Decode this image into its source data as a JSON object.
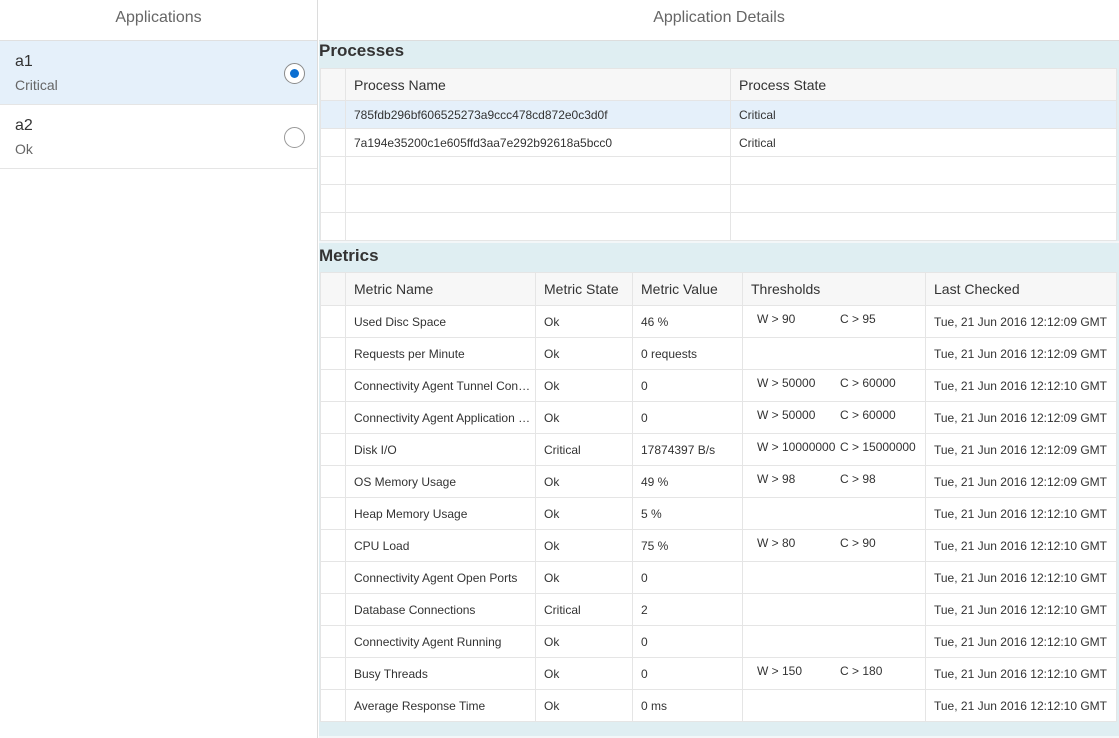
{
  "master": {
    "title": "Applications",
    "items": [
      {
        "name": "a1",
        "status": "Critical",
        "selected": true
      },
      {
        "name": "a2",
        "status": "Ok",
        "selected": false
      }
    ]
  },
  "detail": {
    "title": "Application Details",
    "processes": {
      "title": "Processes",
      "columns": [
        "Process Name",
        "Process State"
      ],
      "rows": [
        {
          "name": "785fdb296bf606525273a9ccc478cd872e0c3d0f",
          "state": "Critical"
        },
        {
          "name": "7a194e35200c1e605ffd3aa7e292b92618a5bcc0",
          "state": "Critical"
        }
      ]
    },
    "metrics": {
      "title": "Metrics",
      "columns": [
        "Metric Name",
        "Metric State",
        "Metric Value",
        "Thresholds",
        "Last Checked"
      ],
      "rows": [
        {
          "name": "Used Disc Space",
          "state": "Ok",
          "value": "46 %",
          "warn": "W > 90",
          "crit": "C > 95",
          "checked": "Tue, 21 Jun 2016 12:12:09 GMT"
        },
        {
          "name": "Requests per Minute",
          "state": "Ok",
          "value": "0 requests",
          "warn": "",
          "crit": "",
          "checked": "Tue, 21 Jun 2016 12:12:09 GMT"
        },
        {
          "name": "Connectivity Agent Tunnel Connections",
          "state": "Ok",
          "value": "0",
          "warn": "W > 50000",
          "crit": "C > 60000",
          "checked": "Tue, 21 Jun 2016 12:12:10 GMT"
        },
        {
          "name": "Connectivity Agent Application Connections",
          "state": "Ok",
          "value": "0",
          "warn": "W > 50000",
          "crit": "C > 60000",
          "checked": "Tue, 21 Jun 2016 12:12:09 GMT"
        },
        {
          "name": "Disk I/O",
          "state": "Critical",
          "value": "17874397 B/s",
          "warn": "W > 10000000",
          "crit": "C > 15000000",
          "checked": "Tue, 21 Jun 2016 12:12:09 GMT"
        },
        {
          "name": "OS Memory Usage",
          "state": "Ok",
          "value": "49 %",
          "warn": "W > 98",
          "crit": "C > 98",
          "checked": "Tue, 21 Jun 2016 12:12:09 GMT"
        },
        {
          "name": "Heap Memory Usage",
          "state": "Ok",
          "value": "5 %",
          "warn": "",
          "crit": "",
          "checked": "Tue, 21 Jun 2016 12:12:10 GMT"
        },
        {
          "name": "CPU Load",
          "state": "Ok",
          "value": "75 %",
          "warn": "W > 80",
          "crit": "C > 90",
          "checked": "Tue, 21 Jun 2016 12:12:10 GMT"
        },
        {
          "name": "Connectivity Agent Open Ports",
          "state": "Ok",
          "value": "0",
          "warn": "",
          "crit": "",
          "checked": "Tue, 21 Jun 2016 12:12:10 GMT"
        },
        {
          "name": "Database Connections",
          "state": "Critical",
          "value": "2",
          "warn": "",
          "crit": "",
          "checked": "Tue, 21 Jun 2016 12:12:10 GMT"
        },
        {
          "name": "Connectivity Agent Running",
          "state": "Ok",
          "value": "0",
          "warn": "",
          "crit": "",
          "checked": "Tue, 21 Jun 2016 12:12:10 GMT"
        },
        {
          "name": "Busy Threads",
          "state": "Ok",
          "value": "0",
          "warn": "W > 150",
          "crit": "C > 180",
          "checked": "Tue, 21 Jun 2016 12:12:10 GMT"
        },
        {
          "name": "Average Response Time",
          "state": "Ok",
          "value": "0 ms",
          "warn": "",
          "crit": "",
          "checked": "Tue, 21 Jun 2016 12:12:10 GMT"
        }
      ]
    }
  },
  "colors": {
    "selection": "#e5f0fa",
    "section": "#dfeef2",
    "accent": "#0a6ed1"
  }
}
